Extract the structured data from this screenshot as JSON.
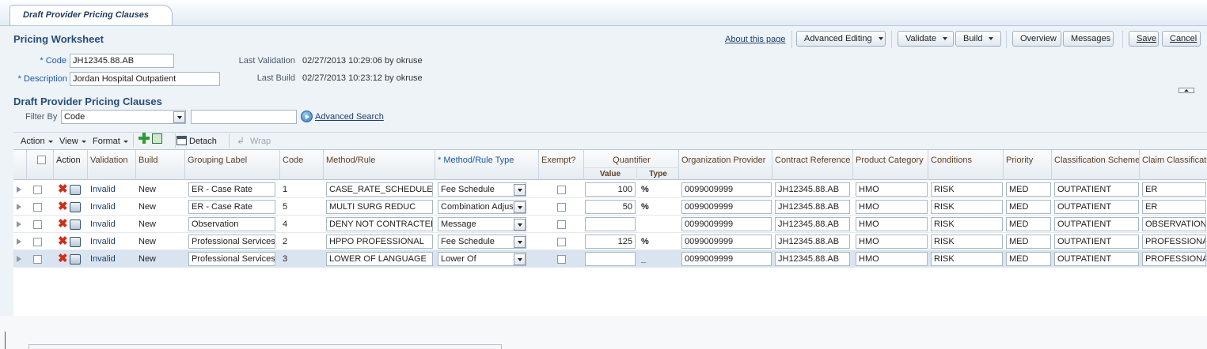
{
  "tab": {
    "title": "Draft Provider Pricing Clauses"
  },
  "worksheet": {
    "title": "Pricing Worksheet",
    "code_label": "* Code",
    "code_value": "JH12345.88.AB",
    "desc_label": "* Description",
    "desc_value": "Jordan Hospital Outpatient",
    "last_validation_label": "Last Validation",
    "last_validation_value": "02/27/2013 10:29:06 by okruse",
    "last_build_label": "Last Build",
    "last_build_value": "02/27/2013 10:23:12 by okruse"
  },
  "toolbar": {
    "about": "About this page",
    "advanced_editing": "Advanced Editing",
    "validate": "Validate",
    "build": "Build",
    "overview": "Overview",
    "messages": "Messages",
    "save": "Save",
    "cancel": "Cancel"
  },
  "clauses": {
    "title": "Draft Provider Pricing Clauses",
    "filter_label": "Filter By",
    "filter_value": "Code",
    "filter_text": "",
    "advanced_search": "Advanced Search"
  },
  "table_toolbar": {
    "action": "Action",
    "view": "View",
    "format": "Format",
    "detach": "Detach",
    "wrap": "Wrap"
  },
  "columns": {
    "action": "Action",
    "validation": "Validation",
    "build": "Build",
    "grouping_label": "Grouping Label",
    "code": "Code",
    "method_rule": "Method/Rule",
    "method_rule_type": "* Method/Rule Type",
    "exempt": "Exempt?",
    "quantifier": "Quantifier",
    "quantifier_value": "Value",
    "quantifier_type": "Type",
    "org_provider": "Organization Provider",
    "contract_ref": "Contract Reference",
    "product_category": "Product Category",
    "conditions": "Conditions",
    "priority": "Priority",
    "classification_scheme": "Classification Scheme",
    "claim_classification": "Claim Classification"
  },
  "rows": [
    {
      "validation": "Invalid",
      "build": "New",
      "grouping": "ER - Case Rate",
      "code": "1",
      "method": "CASE_RATE_SCHEDULE",
      "method_type": "Fee Schedule",
      "value": "100",
      "type": "%",
      "org": "0099009999",
      "contract": "JH12345.88.AB",
      "product": "HMO",
      "conditions": "RISK",
      "priority": "MED",
      "scheme": "OUTPATIENT",
      "claim": "ER"
    },
    {
      "validation": "Invalid",
      "build": "New",
      "grouping": "ER - Case Rate",
      "code": "5",
      "method": "MULTI SURG REDUC",
      "method_type": "Combination Adjustm",
      "value": "50",
      "type": "%",
      "org": "0099009999",
      "contract": "JH12345.88.AB",
      "product": "HMO",
      "conditions": "RISK",
      "priority": "MED",
      "scheme": "OUTPATIENT",
      "claim": "ER"
    },
    {
      "validation": "Invalid",
      "build": "New",
      "grouping": "Observation",
      "code": "4",
      "method": "DENY NOT CONTRACTED",
      "method_type": "Message",
      "value": "",
      "type": "",
      "org": "0099009999",
      "contract": "JH12345.88.AB",
      "product": "HMO",
      "conditions": "RISK",
      "priority": "MED",
      "scheme": "OUTPATIENT",
      "claim": "OBSERVATION"
    },
    {
      "validation": "Invalid",
      "build": "New",
      "grouping": "Professional Services",
      "code": "2",
      "method": "HPPO PROFESSIONAL",
      "method_type": "Fee Schedule",
      "value": "125",
      "type": "%",
      "org": "0099009999",
      "contract": "JH12345.88.AB",
      "product": "HMO",
      "conditions": "RISK",
      "priority": "MED",
      "scheme": "OUTPATIENT",
      "claim": "PROFESSIONAL"
    },
    {
      "validation": "Invalid",
      "build": "New",
      "grouping": "Professional Services",
      "code": "3",
      "method": "LOWER OF LANGUAGE",
      "method_type": "Lower Of",
      "value": "",
      "type": "_",
      "org": "0099009999",
      "contract": "JH12345.88.AB",
      "product": "HMO",
      "conditions": "RISK",
      "priority": "MED",
      "scheme": "OUTPATIENT",
      "claim": "PROFESSIONAL"
    }
  ],
  "colors": {
    "link": "#1c3f6e",
    "header_text": "#5c3e1e",
    "title": "#254e7c",
    "delete_icon": "#d02d1a",
    "add_icon": "#2e9a2e"
  }
}
